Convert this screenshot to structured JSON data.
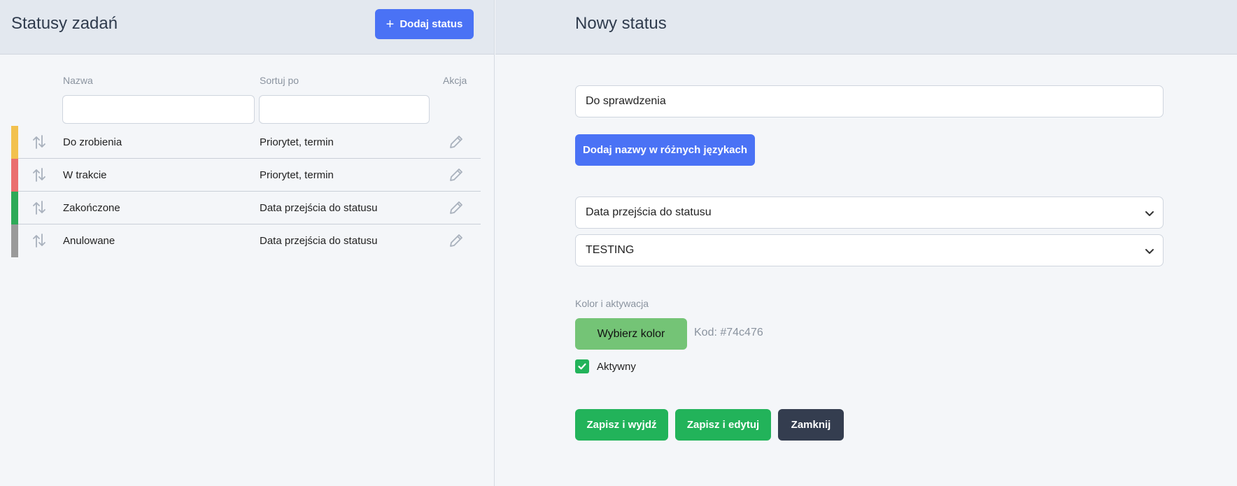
{
  "left": {
    "title": "Statusy zadań",
    "add_button_label": "Dodaj status",
    "columns": {
      "name": "Nazwa",
      "sort_by": "Sortuj po",
      "action": "Akcja"
    },
    "rows": [
      {
        "name": "Do zrobienia",
        "sort_by": "Priorytet, termin",
        "color": "#f2c14e"
      },
      {
        "name": "W trakcie",
        "sort_by": "Priorytet, termin",
        "color": "#ea6f6f"
      },
      {
        "name": "Zakończone",
        "sort_by": "Data przejścia do statusu",
        "color": "#2eaa58"
      },
      {
        "name": "Anulowane",
        "sort_by": "Data przejścia do statusu",
        "color": "#9a9a9a"
      }
    ]
  },
  "right": {
    "title": "Nowy status",
    "name_value": "Do sprawdzenia",
    "lang_button_label": "Dodaj nazwy w różnych językach",
    "sort_select_value": "Data przejścia do statusu",
    "type_select_value": "TESTING",
    "color_section_label": "Kolor i aktywacja",
    "color_button_label": "Wybierz kolor",
    "color_code_label": "Kod: #74c476",
    "selected_color": "#74c476",
    "active_label": "Aktywny",
    "active_checked": true,
    "buttons": {
      "save_exit": "Zapisz i wyjdź",
      "save_edit": "Zapisz i edytuj",
      "close": "Zamknij"
    }
  },
  "colors": {
    "primary": "#4a72f5",
    "success": "#22b35a",
    "dark": "#343d4f"
  }
}
